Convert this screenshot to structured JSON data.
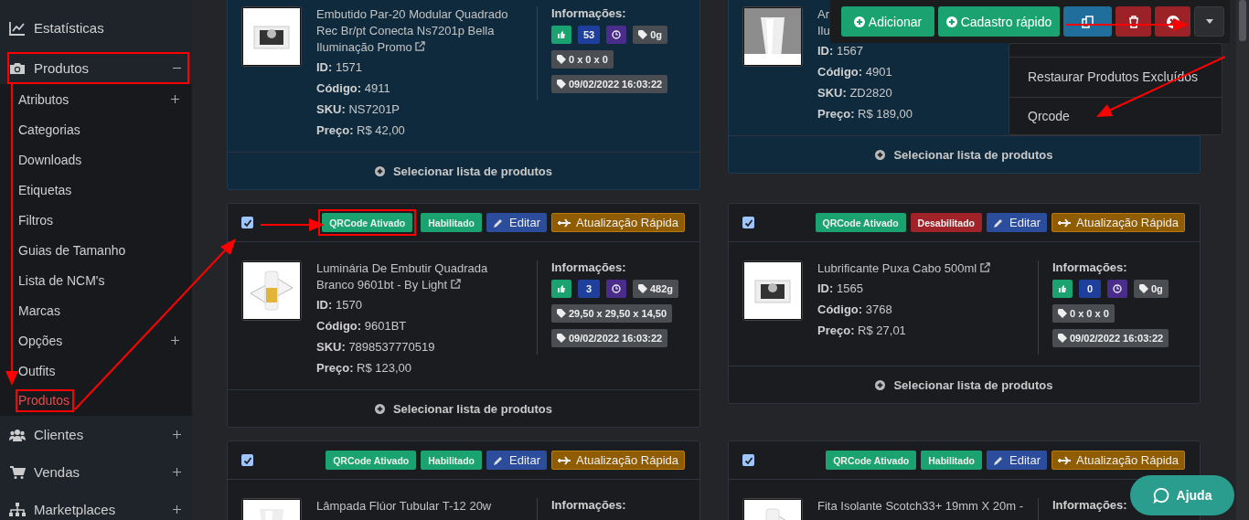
{
  "sidebar": {
    "items": [
      {
        "label": "Estatísticas"
      },
      {
        "label": "Produtos",
        "expanded": true,
        "children": [
          {
            "label": "Atributos",
            "expanded": false,
            "selected": false
          },
          {
            "label": "Categorias",
            "selected": false
          },
          {
            "label": "Downloads",
            "selected": false
          },
          {
            "label": "Etiquetas",
            "selected": false
          },
          {
            "label": "Filtros",
            "selected": false
          },
          {
            "label": "Guias de Tamanho",
            "selected": false
          },
          {
            "label": "Lista de NCM's",
            "selected": false
          },
          {
            "label": "Marcas",
            "selected": false
          },
          {
            "label": "Opções",
            "expanded": false,
            "selected": false
          },
          {
            "label": "Outfits",
            "selected": false
          },
          {
            "label": "Produtos",
            "selected": true
          }
        ]
      },
      {
        "label": "Clientes",
        "expanded": false
      },
      {
        "label": "Vendas",
        "expanded": false
      },
      {
        "label": "Marketplaces",
        "expanded": false
      }
    ]
  },
  "products": [
    {
      "highlighted": true,
      "image": {
        "kind": "picture"
      },
      "title_lines": [
        "Embutido Par-20 Modular Quadrado",
        "Rec Br/pt Conecta Ns7201p Bella",
        "Iluminação Promo"
      ],
      "external_link": true,
      "fields": [
        {
          "label": "ID:",
          "value": "1571"
        },
        {
          "label": "Código:",
          "value": "4911"
        },
        {
          "label": "SKU:",
          "value": "NS7201P"
        },
        {
          "label": "Preço:",
          "value": "R$ 42,00"
        }
      ],
      "info": {
        "label": "Informações:",
        "count": "53",
        "weight": "0g",
        "dimensions": "0 x 0 x 0",
        "date": "09/02/2022 16:03:22"
      },
      "footer": "Selecionar lista de produtos"
    },
    {
      "highlighted": true,
      "image": {
        "kind": "picture"
      },
      "title_lines": [
        "Ar",
        "Ilu"
      ],
      "fields": [
        {
          "label": "ID:",
          "value": "1567"
        },
        {
          "label": "Código:",
          "value": "4901"
        },
        {
          "label": "SKU:",
          "value": "ZD2820"
        },
        {
          "label": "Preço:",
          "value": "R$ 189,00"
        }
      ],
      "footer": "Selecionar lista de produtos"
    },
    {
      "highlighted": false,
      "header": {
        "checked": true,
        "qr": "QRCode Ativado",
        "status": "Habilitado",
        "enabled": true,
        "edit": "Editar",
        "quick": "Atualização Rápida"
      },
      "image": {
        "kind": "picture"
      },
      "title_lines": [
        "Luminária De Embutir Quadrada",
        "Branco 9601bt - By Light"
      ],
      "external_link": true,
      "fields": [
        {
          "label": "ID:",
          "value": "1570"
        },
        {
          "label": "Código:",
          "value": "9601BT"
        },
        {
          "label": "SKU:",
          "value": "7898537770519"
        },
        {
          "label": "Preço:",
          "value": "R$ 123,00"
        }
      ],
      "info": {
        "label": "Informações:",
        "count": "3",
        "weight": "482g",
        "dimensions": "29,50 x 29,50 x 14,50",
        "date": "09/02/2022 16:03:22"
      },
      "footer": "Selecionar lista de produtos"
    },
    {
      "highlighted": false,
      "header": {
        "checked": true,
        "qr": "QRCode Ativado",
        "status": "Desabilitado",
        "enabled": false,
        "edit": "Editar",
        "quick": "Atualização Rápida"
      },
      "image": {
        "kind": "picture"
      },
      "title_lines": [
        "Lubrificante Puxa Cabo 500ml"
      ],
      "external_link": true,
      "fields": [
        {
          "label": "ID:",
          "value": "1565"
        },
        {
          "label": "Código:",
          "value": "3768"
        },
        {
          "label": "Preço:",
          "value": "R$ 27,01"
        }
      ],
      "info": {
        "label": "Informações:",
        "count": "0",
        "weight": "0g",
        "dimensions": "0 x 0 x 0",
        "date": "09/02/2022 16:03:22"
      },
      "footer": "Selecionar lista de produtos"
    },
    {
      "highlighted": false,
      "header": {
        "checked": true,
        "qr": "QRCode Ativado",
        "status": "Habilitado",
        "enabled": true,
        "edit": "Editar",
        "quick": "Atualização Rápida"
      },
      "image": {
        "kind": "picture"
      },
      "title_lines": [
        "Lâmpada Flúor Tubular T-12 20w"
      ],
      "info": {
        "label": "Informações:"
      }
    },
    {
      "highlighted": false,
      "header": {
        "checked": true,
        "qr": "QRCode Ativado",
        "status": "Habilitado",
        "enabled": true,
        "edit": "Editar",
        "quick": "Atualização Rápida"
      },
      "image": {
        "kind": "picture"
      },
      "title_lines": [
        "Fita Isolante Scotch33+ 19mm X 20m -"
      ],
      "info": {
        "label": "Informações:"
      }
    }
  ],
  "toolbar": {
    "buttons": [
      {
        "kind": "add",
        "label": "Adicionar"
      },
      {
        "kind": "quick-add",
        "label": "Cadastro rápido"
      },
      {
        "kind": "copy"
      },
      {
        "kind": "delete"
      },
      {
        "kind": "cancel"
      },
      {
        "kind": "toggle",
        "expanded": true
      }
    ],
    "menu": [
      "Restaurar Produtos Excluídos",
      "Qrcode"
    ]
  },
  "help_button": "Ajuda"
}
